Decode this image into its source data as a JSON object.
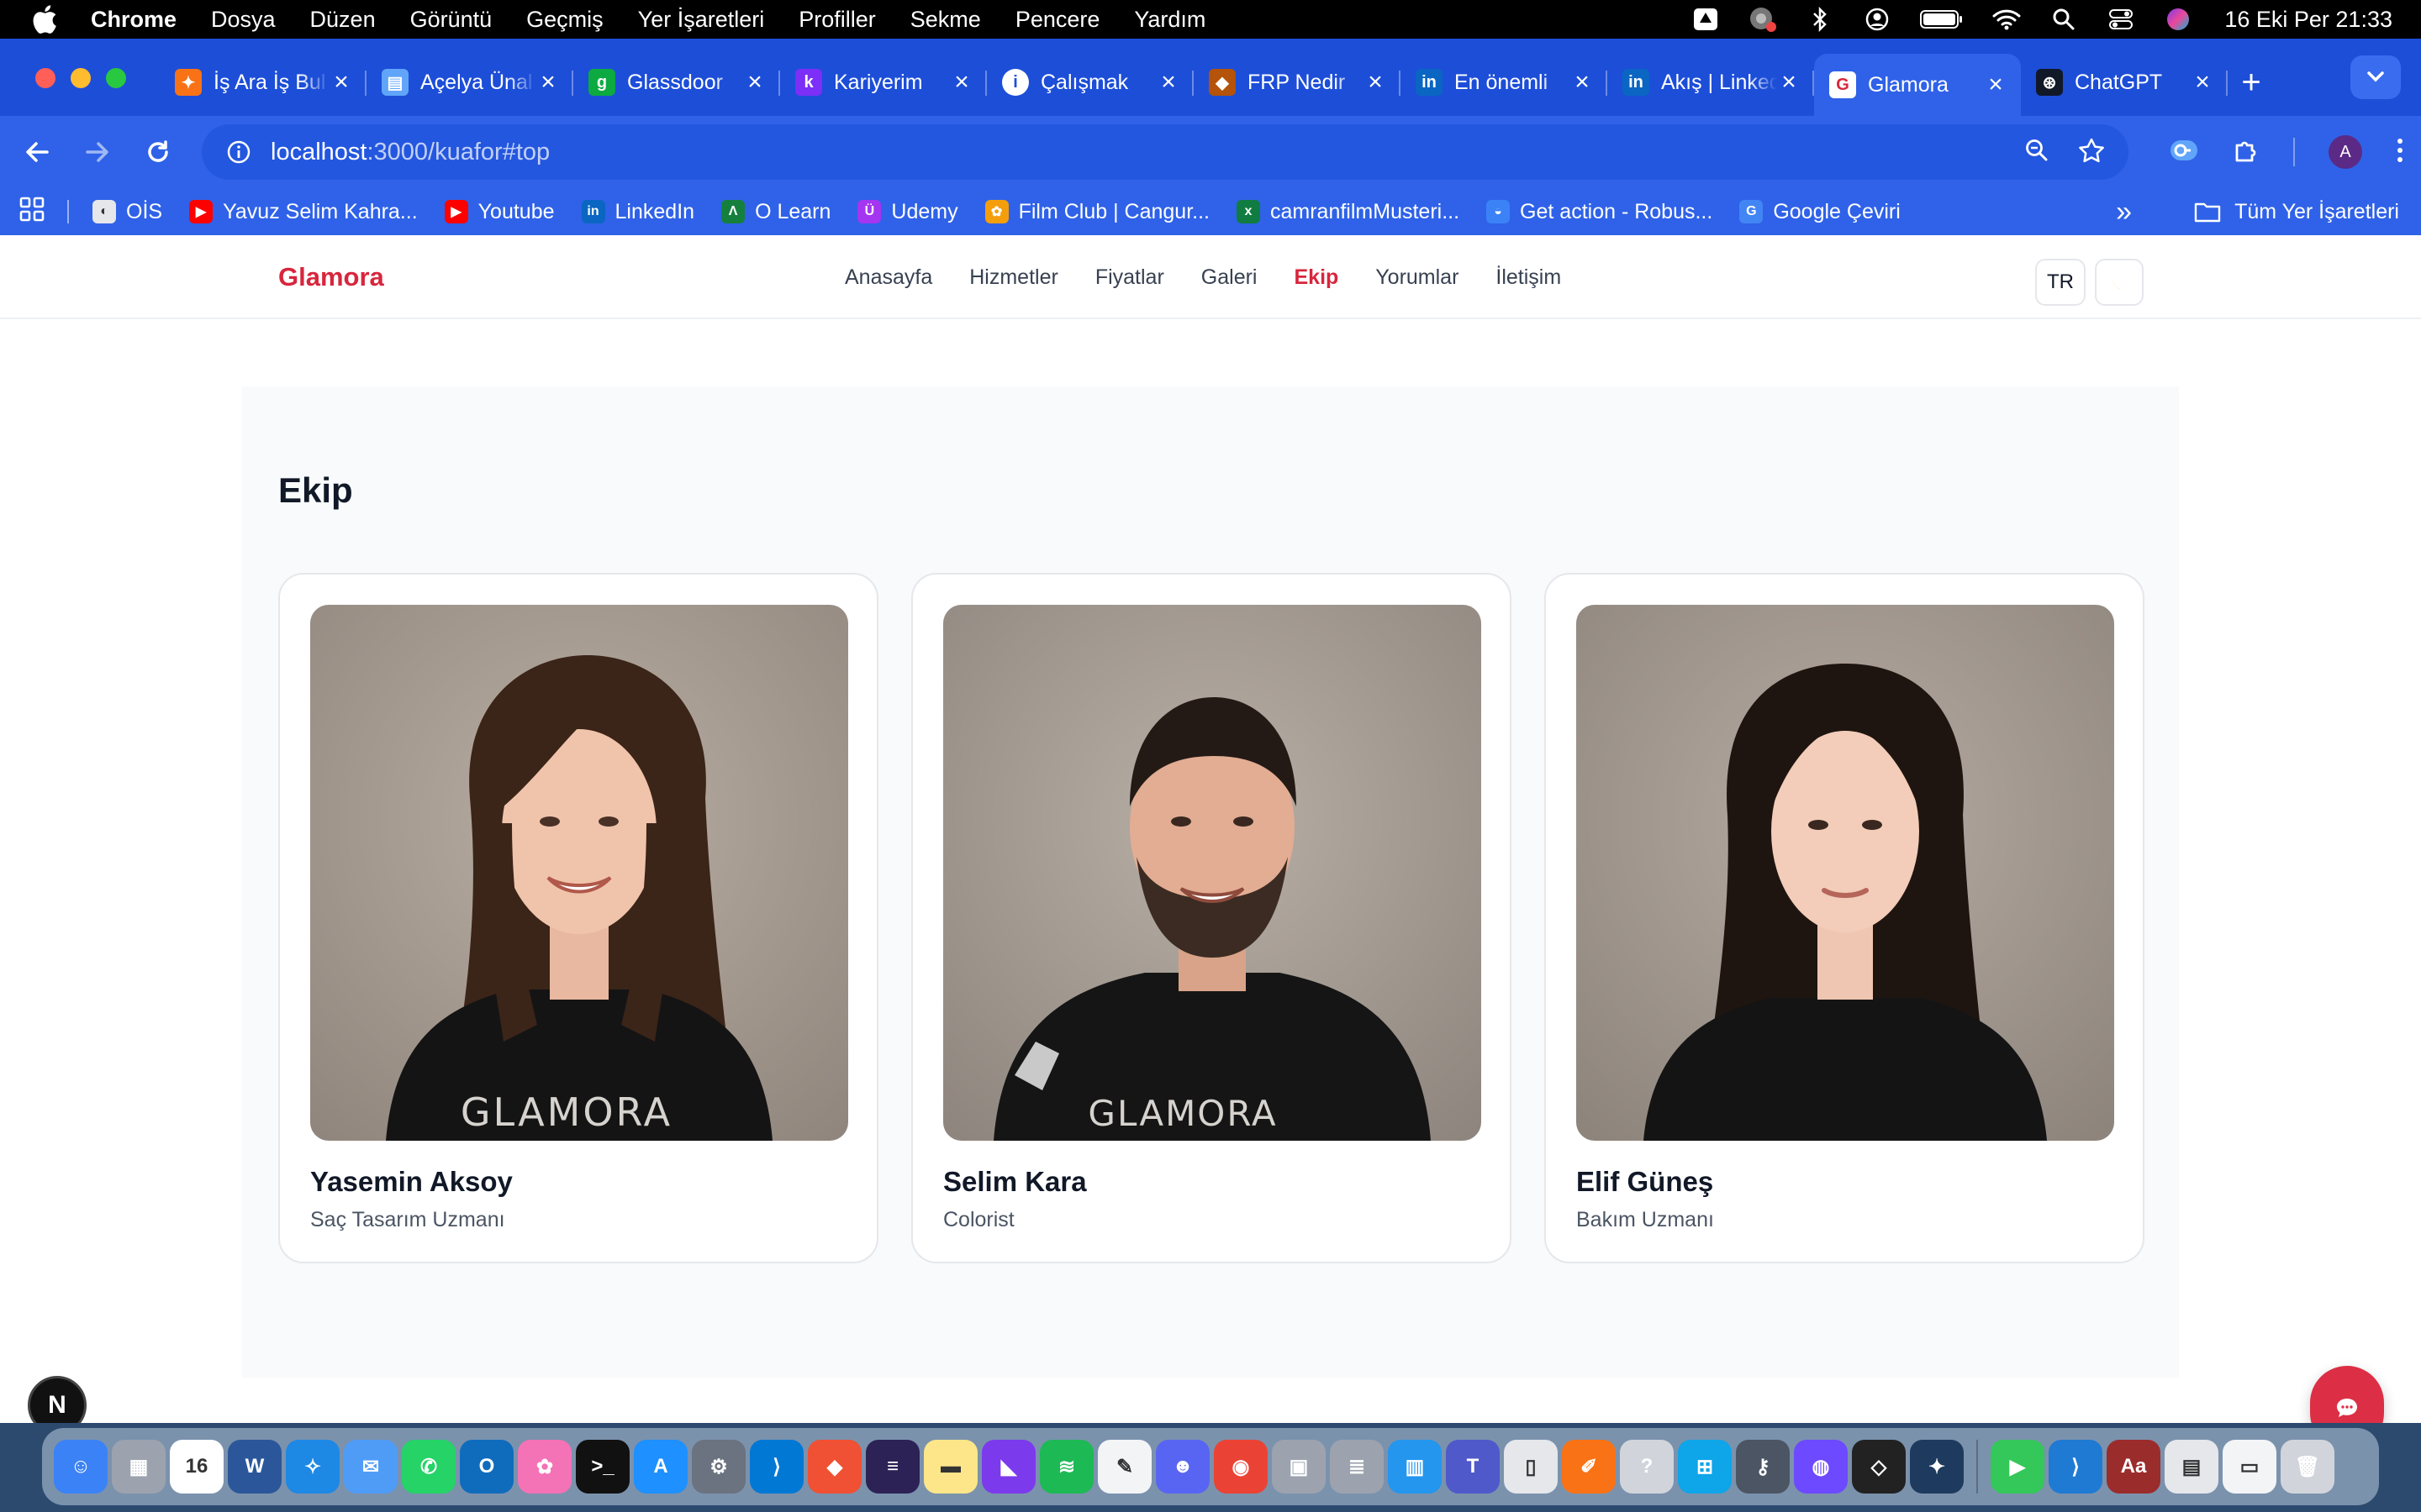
{
  "menubar": {
    "app_name": "Chrome",
    "items": [
      "Dosya",
      "Düzen",
      "Görüntü",
      "Geçmiş",
      "Yer İşaretleri",
      "Profiller",
      "Sekme",
      "Pencere",
      "Yardım"
    ],
    "clock": "16 Eki Per  21:33"
  },
  "tabs": [
    {
      "title": "İş Ara İş Bul",
      "favicon": "kariyer-net-icon",
      "color": "#f97316",
      "glyph": "✦"
    },
    {
      "title": "Açelya Ünal",
      "favicon": "printer-icon",
      "color": "#60a5fa",
      "glyph": "▤"
    },
    {
      "title": "Glassdoor",
      "favicon": "glassdoor-icon",
      "color": "#0caa41",
      "glyph": "g"
    },
    {
      "title": "Kariyerim",
      "favicon": "kariyer-k-icon",
      "color": "#7b2ff7",
      "glyph": "k"
    },
    {
      "title": "Çalışmak",
      "favicon": "info-icon",
      "color": "#ffffff",
      "glyph": "i"
    },
    {
      "title": "FRP Nedir",
      "favicon": "shield-icon",
      "color": "#b45309",
      "glyph": "◆"
    },
    {
      "title": "En önemli",
      "favicon": "linkedin-icon",
      "color": "#0a66c2",
      "glyph": "in"
    },
    {
      "title": "Akış | LinkedIn",
      "favicon": "linkedin-icon",
      "color": "#0a66c2",
      "glyph": "in"
    },
    {
      "title": "Glamora",
      "favicon": "glamora-icon",
      "color": "#ffffff",
      "glyph": "G",
      "active": true
    },
    {
      "title": "ChatGPT",
      "favicon": "chatgpt-icon",
      "color": "#111827",
      "glyph": "⊛"
    }
  ],
  "address_bar": {
    "host": "localhost",
    "path": ":3000/kuafor#top"
  },
  "bookmarks": [
    {
      "label": "OİS",
      "icon": "ois-icon",
      "color": "#e5e7eb",
      "glyph": "◐"
    },
    {
      "label": "Yavuz Selim Kahra...",
      "icon": "youtube-icon",
      "color": "#ff0000",
      "glyph": "▶"
    },
    {
      "label": "Youtube",
      "icon": "youtube-icon",
      "color": "#ff0000",
      "glyph": "▶"
    },
    {
      "label": "LinkedIn",
      "icon": "linkedin-icon",
      "color": "#0a66c2",
      "glyph": "in"
    },
    {
      "label": "O Learn",
      "icon": "olearn-icon",
      "color": "#15803d",
      "glyph": "Λ"
    },
    {
      "label": "Udemy",
      "icon": "udemy-icon",
      "color": "#a435f0",
      "glyph": "Ü"
    },
    {
      "label": "Film Club | Cangur...",
      "icon": "kangaroo-icon",
      "color": "#f59e0b",
      "glyph": "✿"
    },
    {
      "label": "camranfilmMusteri...",
      "icon": "excel-icon",
      "color": "#107c41",
      "glyph": "x"
    },
    {
      "label": "Get action - Robus...",
      "icon": "robusta-icon",
      "color": "#3b82f6",
      "glyph": "◒"
    },
    {
      "label": "Google Çeviri",
      "icon": "google-translate-icon",
      "color": "#4285f4",
      "glyph": "G"
    }
  ],
  "bookmarks_all": "Tüm Yer İşaretleri",
  "site": {
    "brand": "Glamora",
    "nav": [
      "Anasayfa",
      "Hizmetler",
      "Fiyatlar",
      "Galeri",
      "Ekip",
      "Yorumlar",
      "İletişim"
    ],
    "active_nav": "Ekip",
    "lang": "TR",
    "accent": "#d7263d"
  },
  "team": {
    "title": "Ekip",
    "members": [
      {
        "name": "Yasemin Aksoy",
        "role": "Saç Tasarım Uzmanı",
        "apron": "GLAMORA"
      },
      {
        "name": "Selim Kara",
        "role": "Colorist",
        "apron": "GLAMORA"
      },
      {
        "name": "Elif Güneş",
        "role": "Bakım Uzmanı",
        "apron": ""
      }
    ]
  },
  "nextjs_badge": "N",
  "dock": [
    {
      "name": "finder-icon",
      "color": "#3b82f6",
      "glyph": "☺"
    },
    {
      "name": "launchpad-icon",
      "color": "#9ca3af",
      "glyph": "▦"
    },
    {
      "name": "calendar-icon",
      "color": "#ffffff",
      "glyph": "16",
      "dark": true
    },
    {
      "name": "word-icon",
      "color": "#2b579a",
      "glyph": "W"
    },
    {
      "name": "safari-icon",
      "color": "#1e88e5",
      "glyph": "✧"
    },
    {
      "name": "mail-icon",
      "color": "#4f9cf7",
      "glyph": "✉"
    },
    {
      "name": "whatsapp-icon",
      "color": "#25d366",
      "glyph": "✆"
    },
    {
      "name": "outlook-icon",
      "color": "#0f6cbd",
      "glyph": "O"
    },
    {
      "name": "photos-icon",
      "color": "#f472b6",
      "glyph": "✿"
    },
    {
      "name": "terminal-icon",
      "color": "#111111",
      "glyph": ">_"
    },
    {
      "name": "app-store-icon",
      "color": "#1e90ff",
      "glyph": "A"
    },
    {
      "name": "system-settings-icon",
      "color": "#6b7280",
      "glyph": "⚙"
    },
    {
      "name": "vscode-icon",
      "color": "#0078d4",
      "glyph": "⟩"
    },
    {
      "name": "git-icon",
      "color": "#f05033",
      "glyph": "◆"
    },
    {
      "name": "eclipse-icon",
      "color": "#2c2255",
      "glyph": "≡"
    },
    {
      "name": "notes-icon",
      "color": "#fde68a",
      "glyph": "▬",
      "dark": true
    },
    {
      "name": "visual-studio-icon",
      "color": "#7c3aed",
      "glyph": "◣"
    },
    {
      "name": "spotify-icon",
      "color": "#1db954",
      "glyph": "≋"
    },
    {
      "name": "textedit-icon",
      "color": "#f3f4f6",
      "glyph": "✎",
      "dark": true
    },
    {
      "name": "discord-icon",
      "color": "#5865f2",
      "glyph": "☻"
    },
    {
      "name": "chrome-icon",
      "color": "#ea4335",
      "glyph": "◉"
    },
    {
      "name": "preview-icon",
      "color": "#9ca3af",
      "glyph": "▣"
    },
    {
      "name": "database-icon",
      "color": "#9ca3af",
      "glyph": "≣"
    },
    {
      "name": "docker-icon",
      "color": "#2496ed",
      "glyph": "▥"
    },
    {
      "name": "teams-icon",
      "color": "#5059c9",
      "glyph": "T"
    },
    {
      "name": "iphone-mirroring-icon",
      "color": "#e5e7eb",
      "glyph": "▯",
      "dark": true
    },
    {
      "name": "pencil-app-icon",
      "color": "#f97316",
      "glyph": "✐"
    },
    {
      "name": "help-icon",
      "color": "#d1d5db",
      "glyph": "?"
    },
    {
      "name": "windows-app-icon",
      "color": "#0ea5e9",
      "glyph": "⊞"
    },
    {
      "name": "keychain-icon",
      "color": "#4b5563",
      "glyph": "⚷"
    },
    {
      "name": "proton-icon",
      "color": "#6d4aff",
      "glyph": "◍"
    },
    {
      "name": "unity-icon",
      "color": "#222222",
      "glyph": "◇"
    },
    {
      "name": "mysql-workbench-icon",
      "color": "#1e3a5f",
      "glyph": "✦"
    },
    {
      "name": "facetime-icon",
      "color": "#34c759",
      "glyph": "▶"
    },
    {
      "name": "vscode-insiders-icon",
      "color": "#1f7ad4",
      "glyph": "⟩"
    },
    {
      "name": "dictionary-icon",
      "color": "#9b2c2c",
      "glyph": "Aa"
    },
    {
      "name": "downloads-stack-icon",
      "color": "#e5e7eb",
      "glyph": "▤",
      "dark": true
    },
    {
      "name": "screenshots-stack-icon",
      "color": "#f3f4f6",
      "glyph": "▭",
      "dark": true
    },
    {
      "name": "trash-icon",
      "color": "#d1d5db",
      "glyph": "🗑"
    }
  ]
}
